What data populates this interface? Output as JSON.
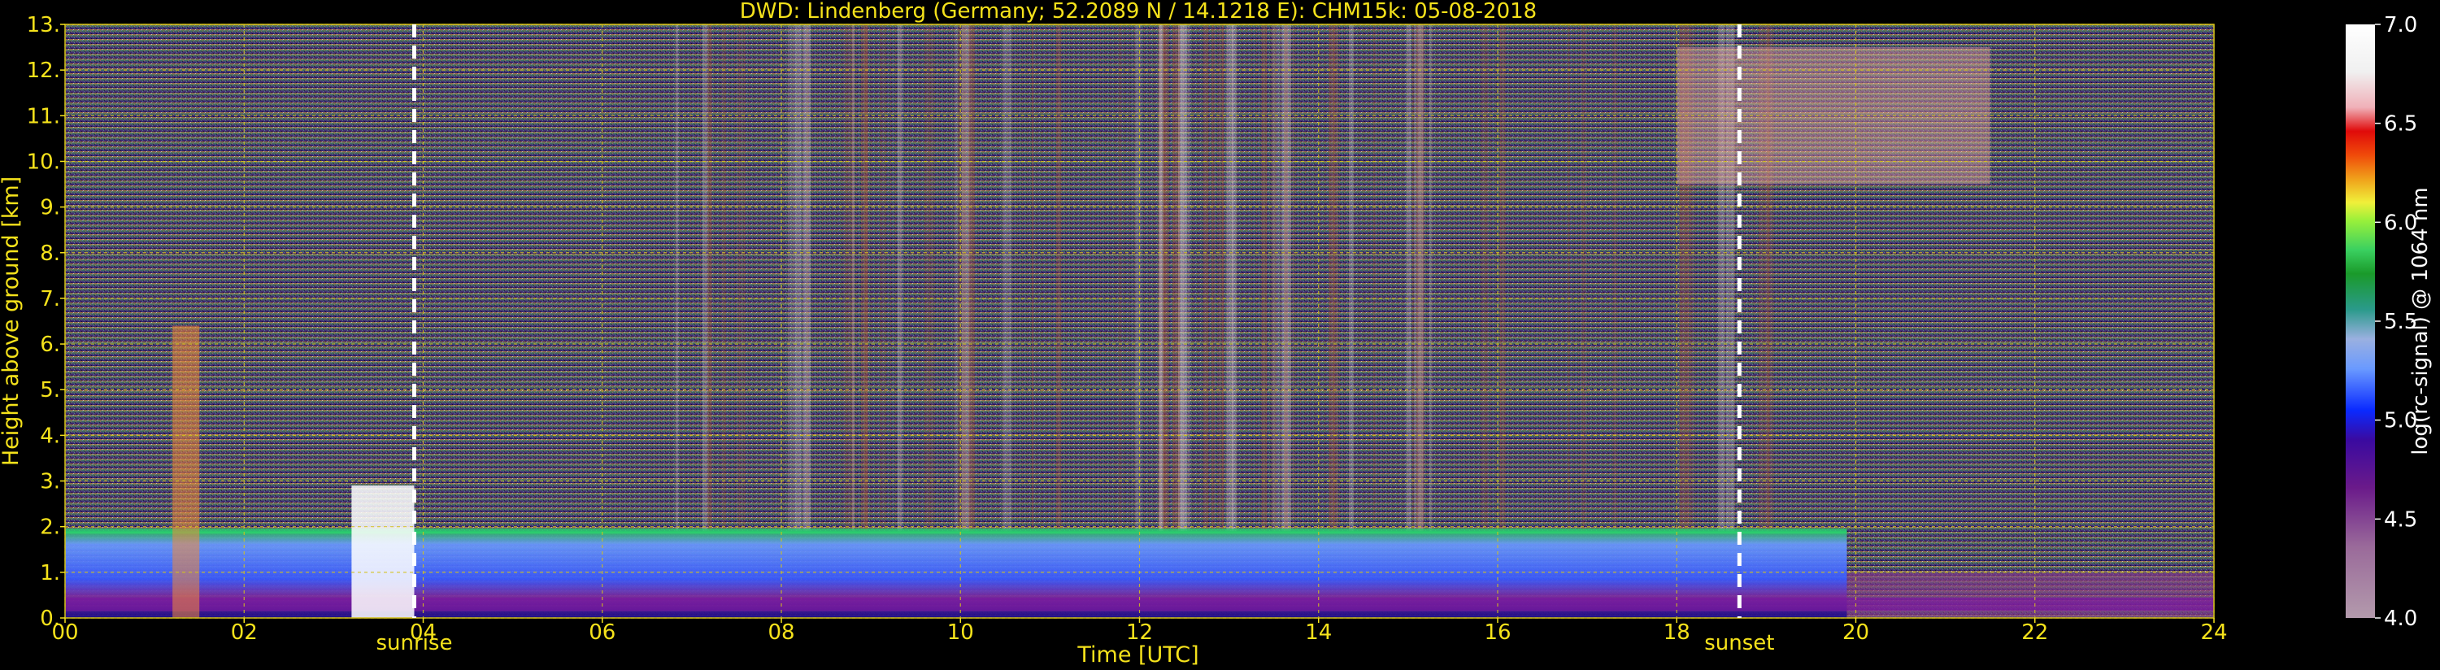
{
  "chart_data": {
    "type": "heatmap",
    "title": "DWD: Lindenberg (Germany; 52.2089 N / 14.1218 E):    CHM15k: 05-08-2018",
    "xlabel": "Time [UTC]",
    "ylabel": "Height above ground [km]",
    "xlim": [
      0,
      24
    ],
    "ylim": [
      0,
      13
    ],
    "x_ticks": [
      "00",
      "02",
      "04",
      "06",
      "08",
      "10",
      "12",
      "14",
      "16",
      "18",
      "20",
      "22",
      "24"
    ],
    "y_ticks": [
      "0.",
      "1.",
      "2.",
      "3.",
      "4.",
      "5.",
      "6.",
      "7.",
      "8.",
      "9.",
      "10.",
      "11.",
      "12.",
      "13."
    ],
    "grid": true,
    "colorbar": {
      "label": "log(rc-signal) @ 1064 nm",
      "range": [
        4.0,
        7.0
      ],
      "ticks": [
        "4.0",
        "4.5",
        "5.0",
        "5.5",
        "6.0",
        "6.5",
        "7.0"
      ]
    },
    "events": [
      {
        "label": "sunrise",
        "x": 3.9
      },
      {
        "label": "sunset",
        "x": 18.7
      }
    ],
    "features": {
      "boundary_layer_top_km": 1.9,
      "cirrus_layer_km": [
        9.5,
        12.5
      ],
      "cirrus_hours": [
        18.0,
        21.5
      ],
      "fog_low_cloud_hours": [
        3.2,
        3.9
      ]
    }
  },
  "colors": {
    "background": "#000000",
    "text_axes": "#f5e21b",
    "grid": "#d4c21a",
    "event_line": "#ffffff",
    "colorbar_label": "#ffffff"
  }
}
